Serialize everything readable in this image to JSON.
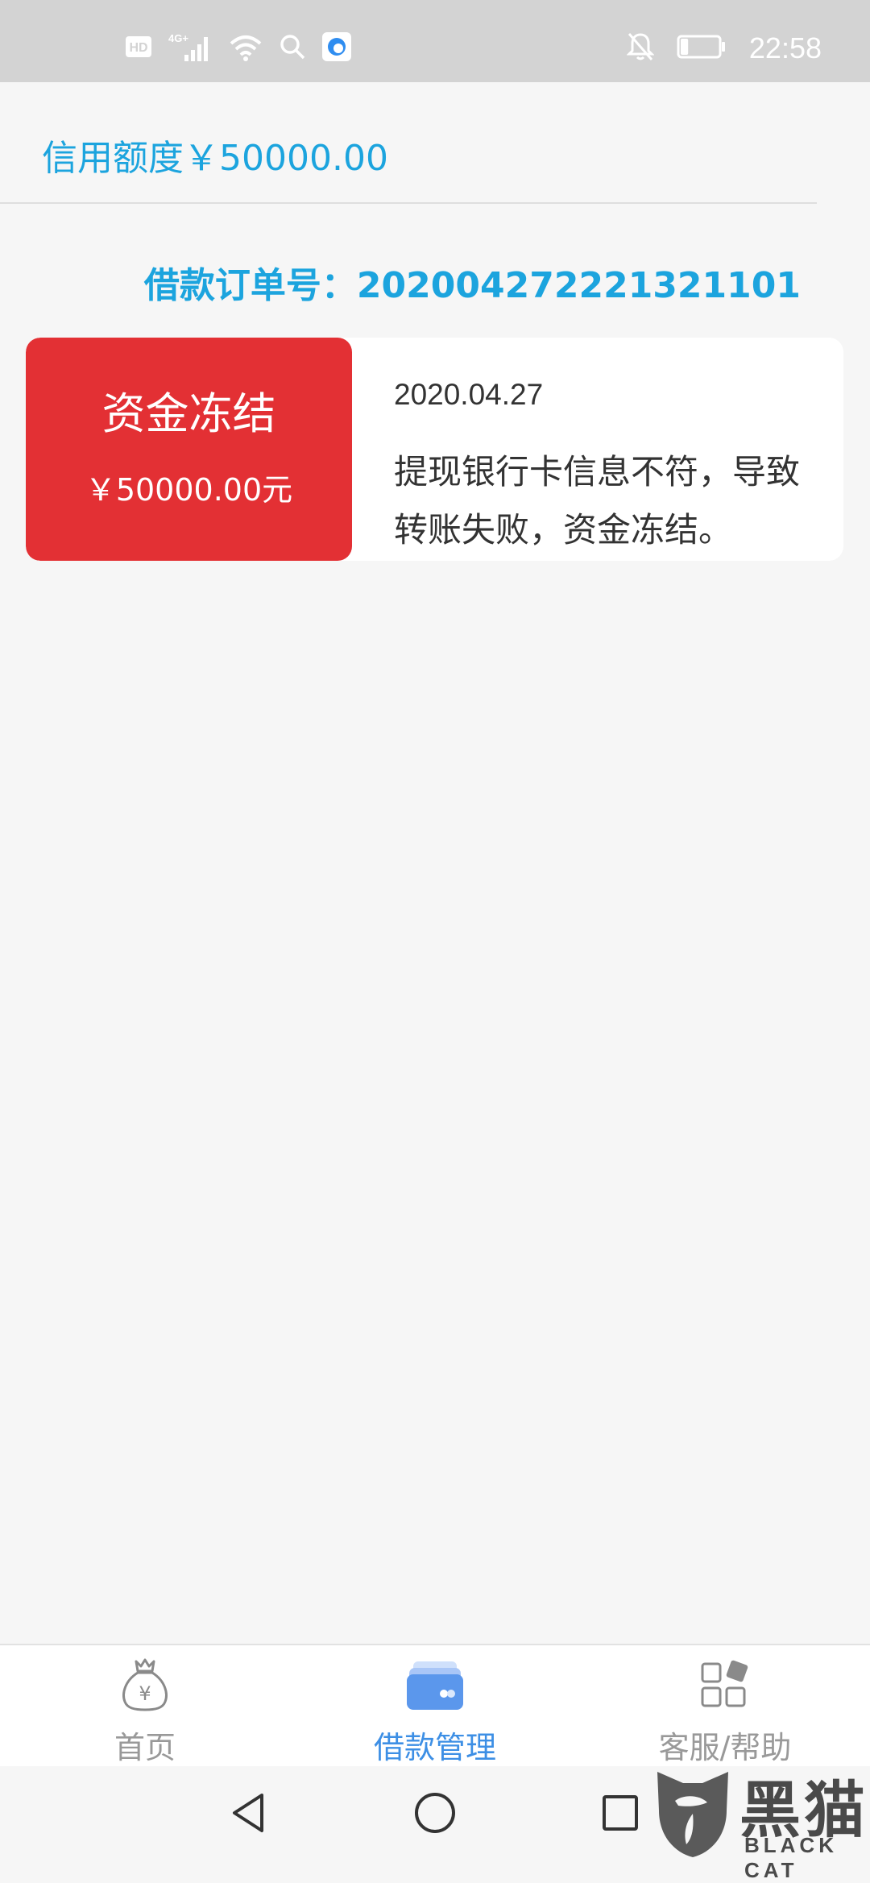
{
  "status_bar": {
    "time": "22:58",
    "hd_label": "HD",
    "network_label": "4G+",
    "icons": [
      "hd-icon",
      "signal-icon",
      "wifi-icon",
      "search-icon",
      "app-notification-icon",
      "mute-icon",
      "battery-icon"
    ],
    "battery_level": 0.2
  },
  "credit": {
    "text": "信用额度￥50000.00"
  },
  "order": {
    "text": "借款订单号：202004272221321101"
  },
  "card": {
    "status": "资金冻结",
    "amount": "￥50000.00元",
    "date": "2020.04.27",
    "description": "提现银行卡信息不符，导致转账失败，资金冻结。",
    "status_color": "#e33034"
  },
  "bottom_nav": {
    "items": [
      {
        "label": "首页",
        "icon": "money-bag-icon",
        "active": false
      },
      {
        "label": "借款管理",
        "icon": "cards-icon",
        "active": true
      },
      {
        "label": "客服/帮助",
        "icon": "grid-icon",
        "active": false
      }
    ],
    "active_color": "#3d8fe5",
    "inactive_color": "#999999"
  },
  "system_nav": {
    "icons": [
      "back-icon",
      "home-icon",
      "recent-apps-icon"
    ]
  },
  "watermark": {
    "title": "黑猫",
    "subtitle": "BLACK CAT"
  },
  "colors": {
    "accent": "#1ca4de",
    "status_bar": "#d3d3d3",
    "background": "#f6f6f6"
  }
}
